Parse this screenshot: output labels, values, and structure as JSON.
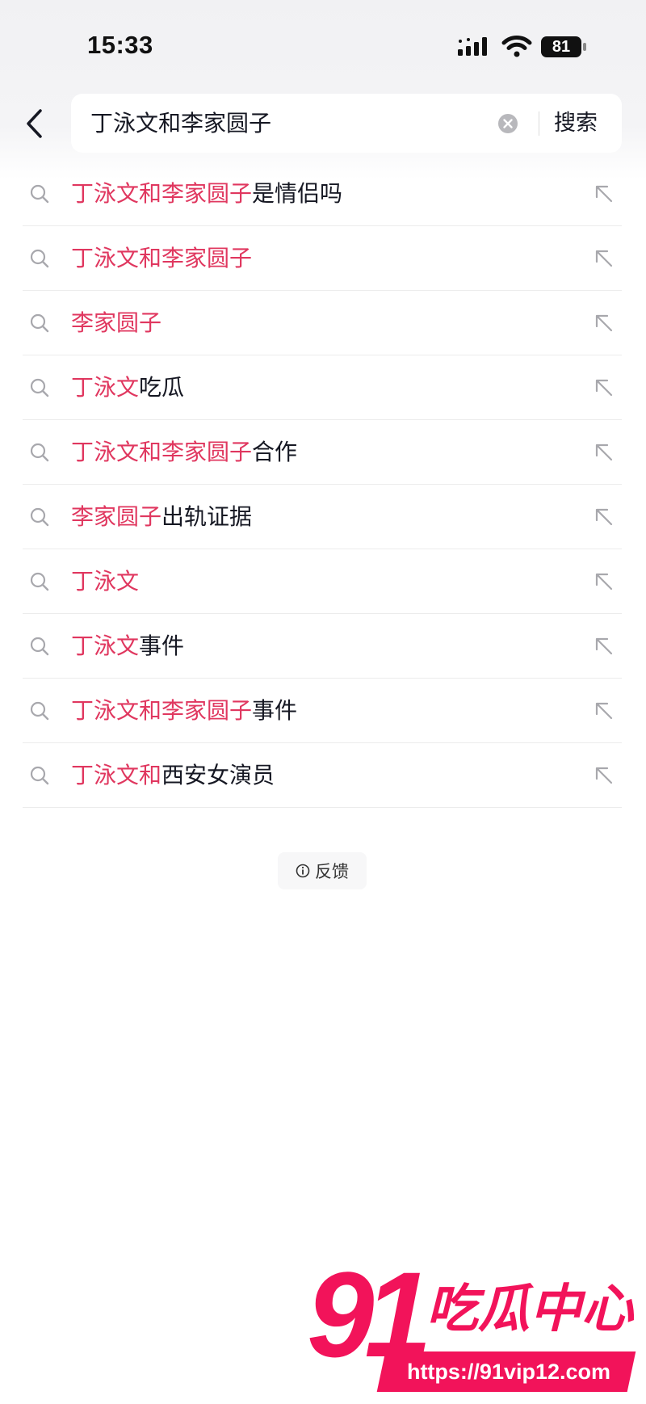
{
  "status_bar": {
    "time": "15:33",
    "battery": "81"
  },
  "search": {
    "query": "丁泳文和李家圆子",
    "button_label": "搜索"
  },
  "suggestions": [
    {
      "highlight": "丁泳文和李家圆子",
      "rest": "是情侣吗"
    },
    {
      "highlight": "丁泳文和李家圆子",
      "rest": ""
    },
    {
      "highlight": "李家圆子",
      "rest": ""
    },
    {
      "highlight": "丁泳文",
      "rest": "吃瓜"
    },
    {
      "highlight": "丁泳文和李家圆子",
      "rest": "合作"
    },
    {
      "highlight": "李家圆子",
      "rest": "出轨证据"
    },
    {
      "highlight": "丁泳文",
      "rest": ""
    },
    {
      "highlight": "丁泳文",
      "rest": "事件"
    },
    {
      "highlight": "丁泳文和李家圆子",
      "rest": "事件"
    },
    {
      "highlight": "丁泳文和",
      "rest": "西安女演员"
    }
  ],
  "feedback": {
    "label": "反馈"
  },
  "watermark": {
    "number": "91",
    "text": "吃瓜中心",
    "url": "https://91vip12.com"
  },
  "colors": {
    "highlight": "#e0375f",
    "text": "#161823",
    "brand": "#f2135a"
  },
  "icons": {
    "back": "chevron-left-icon",
    "clear": "clear-circle-icon",
    "suggest": "search-icon",
    "fill": "arrow-up-left-icon",
    "info": "info-icon",
    "signal": "cellular-signal-icon",
    "wifi": "wifi-icon",
    "battery": "battery-icon"
  }
}
